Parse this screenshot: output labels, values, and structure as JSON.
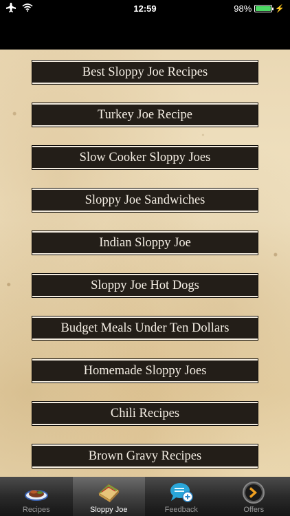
{
  "status_bar": {
    "time": "12:59",
    "battery": "98%",
    "battery_level": 0.98,
    "icons": [
      "airplane-icon",
      "wifi-icon",
      "battery-icon",
      "charging-bolt-icon"
    ]
  },
  "recipes": [
    {
      "label": "Best Sloppy Joe Recipes"
    },
    {
      "label": "Turkey Joe Recipe"
    },
    {
      "label": "Slow Cooker Sloppy Joes"
    },
    {
      "label": "Sloppy Joe Sandwiches"
    },
    {
      "label": "Indian Sloppy Joe"
    },
    {
      "label": "Sloppy Joe Hot Dogs"
    },
    {
      "label": "Budget Meals Under Ten Dollars"
    },
    {
      "label": "Homemade Sloppy Joes"
    },
    {
      "label": "Chili Recipes"
    },
    {
      "label": "Brown Gravy Recipes"
    }
  ],
  "tabs": [
    {
      "label": "Recipes",
      "icon": "food-plate-icon",
      "active": false
    },
    {
      "label": "Sloppy Joe",
      "icon": "sandwich-icon",
      "active": true
    },
    {
      "label": "Feedback",
      "icon": "chat-bubble-plus-icon",
      "active": false
    },
    {
      "label": "Offers",
      "icon": "chevron-circle-icon",
      "active": false
    }
  ],
  "colors": {
    "button_bg": "#231e18",
    "button_text": "#f4eee4",
    "parchment": "#ead8b4",
    "battery_green": "#4cd964"
  }
}
